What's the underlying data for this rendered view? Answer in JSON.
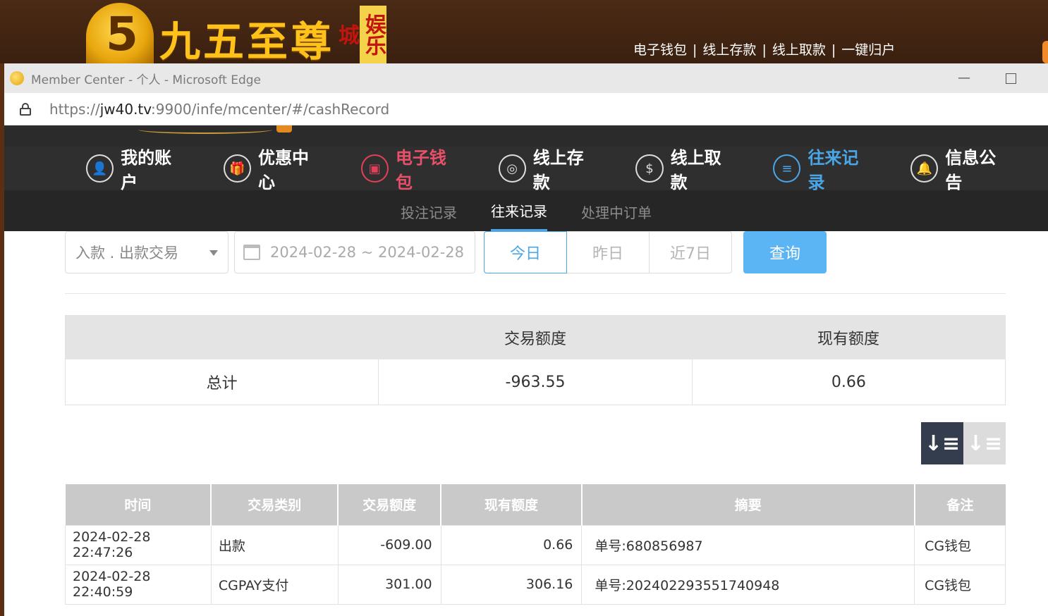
{
  "site": {
    "logo_digit": "5",
    "logo_text": "九五至尊",
    "logo_tag": "娱乐城",
    "top_links": [
      "电子钱包",
      "线上存款",
      "线上取款",
      "一键归户"
    ],
    "top_link_sep": "|"
  },
  "window": {
    "title": "Member Center - 个人 - Microsoft Edge",
    "min_glyph": "—",
    "url_prefix": "https://",
    "url_host": "jw40.tv",
    "url_rest": ":9900/infe/mcenter/#/cashRecord"
  },
  "mainnav": [
    {
      "label": "我的账户",
      "icon": "user-icon",
      "glyph": "👤"
    },
    {
      "label": "优惠中心",
      "icon": "gift-icon",
      "glyph": "🎁"
    },
    {
      "label": "电子钱包",
      "icon": "wallet-icon",
      "glyph": "▣"
    },
    {
      "label": "线上存款",
      "icon": "deposit-icon",
      "glyph": "◎"
    },
    {
      "label": "线上取款",
      "icon": "withdraw-icon",
      "glyph": "$"
    },
    {
      "label": "往来记录",
      "icon": "records-icon",
      "glyph": "≡"
    },
    {
      "label": "信息公告",
      "icon": "bell-icon",
      "glyph": "🔔"
    }
  ],
  "subnav": [
    "投注记录",
    "往来记录",
    "处理中订单"
  ],
  "filters": {
    "type_select": "入款 . 出款交易",
    "date_range": "2024-02-28 ~ 2024-02-28",
    "quick": [
      "今日",
      "昨日",
      "近7日"
    ],
    "query_label": "查询"
  },
  "summary": {
    "headers": [
      "",
      "交易额度",
      "现有额度"
    ],
    "row": [
      "总计",
      "-963.55",
      "0.66"
    ]
  },
  "sort": {
    "desc_glyph": "↓≡",
    "asc_glyph": "↓≡"
  },
  "records": {
    "headers": [
      "时间",
      "交易类别",
      "交易额度",
      "现有额度",
      "摘要",
      "备注"
    ],
    "rows": [
      [
        "2024-02-28 22:47:26",
        "出款",
        "-609.00",
        "0.66",
        "单号:680856987",
        "CG钱包"
      ],
      [
        "2024-02-28 22:40:59",
        "CGPAY支付",
        "301.00",
        "306.16",
        "单号:202402293551740948",
        "CG钱包"
      ]
    ]
  },
  "colors": {
    "accent_blue": "#4aa6e6",
    "accent_red": "#e8506a",
    "query_button": "#5bb4f4",
    "nav_bg": "#2f2f2f"
  }
}
